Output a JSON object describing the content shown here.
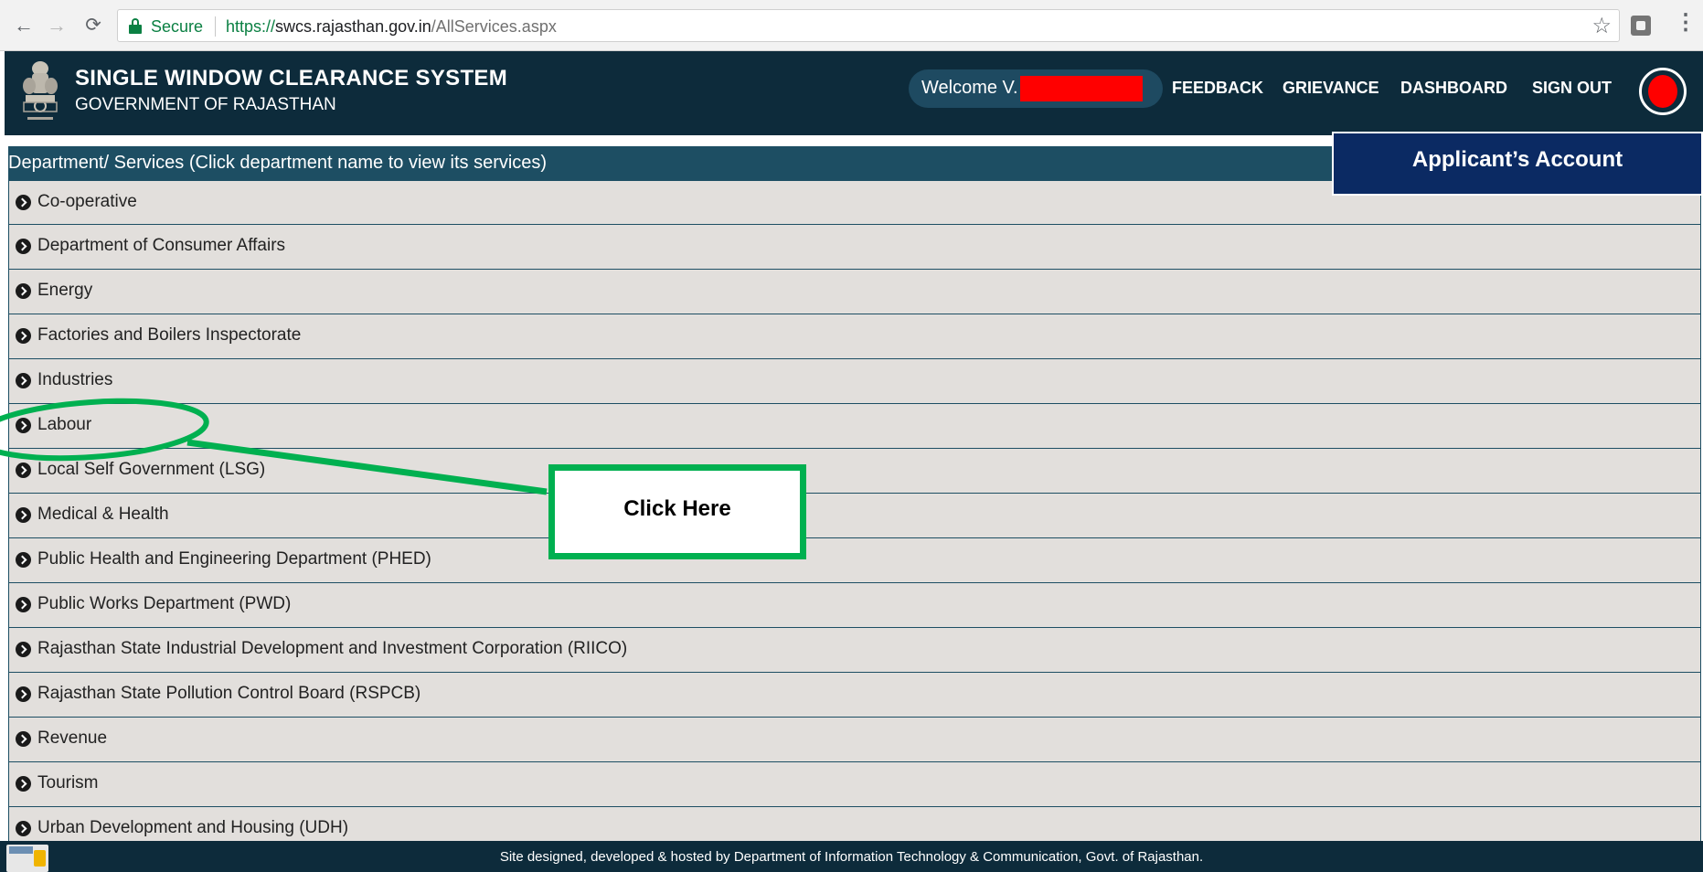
{
  "browser": {
    "secure_label": "Secure",
    "url_scheme": "https://",
    "url_host": "swcs.rajasthan.gov.in",
    "url_path": "/AllServices.aspx"
  },
  "header": {
    "title": "SINGLE WINDOW CLEARANCE SYSTEM",
    "subtitle": "GOVERNMENT OF RAJASTHAN",
    "welcome": "Welcome V.",
    "nav": {
      "feedback": "FEEDBACK",
      "grievance": "GRIEVANCE",
      "dashboard": "DASHBOARD",
      "signout": "SIGN OUT"
    }
  },
  "panel": {
    "heading": "Department/ Services (Click department name to view its services)",
    "departments": [
      "Co-operative",
      "Department of Consumer Affairs",
      "Energy",
      "Factories and Boilers Inspectorate",
      "Industries",
      "Labour",
      "Local Self Government (LSG)",
      "Medical & Health",
      "Public Health and Engineering Department (PHED)",
      "Public Works Department (PWD)",
      "Rajasthan State Industrial Development and Investment Corporation (RIICO)",
      "Rajasthan State Pollution Control Board (RSPCB)",
      "Revenue",
      "Tourism",
      "Urban Development and Housing (UDH)"
    ]
  },
  "annotations": {
    "applicant_account": "Applicant’s Account",
    "click_here": "Click Here",
    "highlight_color": "#00b050"
  },
  "footer": {
    "text": "Site designed, developed & hosted by Department of Information Technology & Communication, Govt. of Rajasthan."
  },
  "colors": {
    "header_bg": "#0d2b3b",
    "panel_head_bg": "#1d4e63",
    "row_bg": "#e2dfdc",
    "account_box_bg": "#0b2a63"
  }
}
